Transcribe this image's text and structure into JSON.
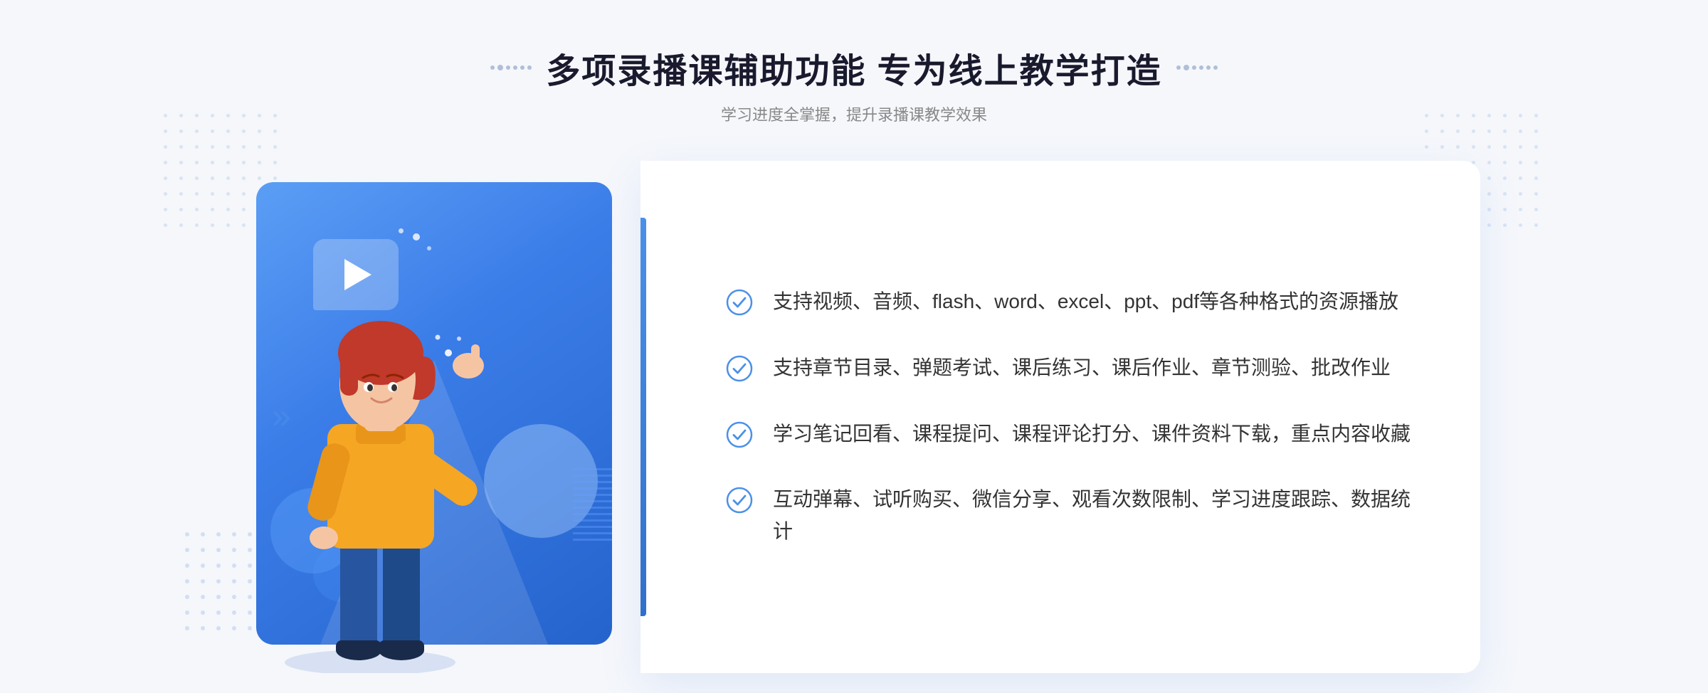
{
  "page": {
    "background_color": "#f5f7fb"
  },
  "header": {
    "main_title": "多项录播课辅助功能 专为线上教学打造",
    "sub_title": "学习进度全掌握，提升录播课教学效果",
    "title_deco_left": "⁞⁞",
    "title_deco_right": "⁞⁞"
  },
  "features": [
    {
      "id": 1,
      "text": "支持视频、音频、flash、word、excel、ppt、pdf等各种格式的资源播放"
    },
    {
      "id": 2,
      "text": "支持章节目录、弹题考试、课后练习、课后作业、章节测验、批改作业"
    },
    {
      "id": 3,
      "text": "学习笔记回看、课程提问、课程评论打分、课件资料下载，重点内容收藏"
    },
    {
      "id": 4,
      "text": "互动弹幕、试听购买、微信分享、观看次数限制、学习进度跟踪、数据统计"
    }
  ],
  "icons": {
    "check_circle": "check-circle-icon",
    "play": "play-icon",
    "chevron_left": "«"
  },
  "colors": {
    "primary_blue": "#3b7de8",
    "light_blue": "#5b9ef5",
    "text_dark": "#333333",
    "text_sub": "#888888",
    "bg_page": "#f5f7fb",
    "white": "#ffffff"
  },
  "left_arrow": "»",
  "chevrons_left": "«"
}
